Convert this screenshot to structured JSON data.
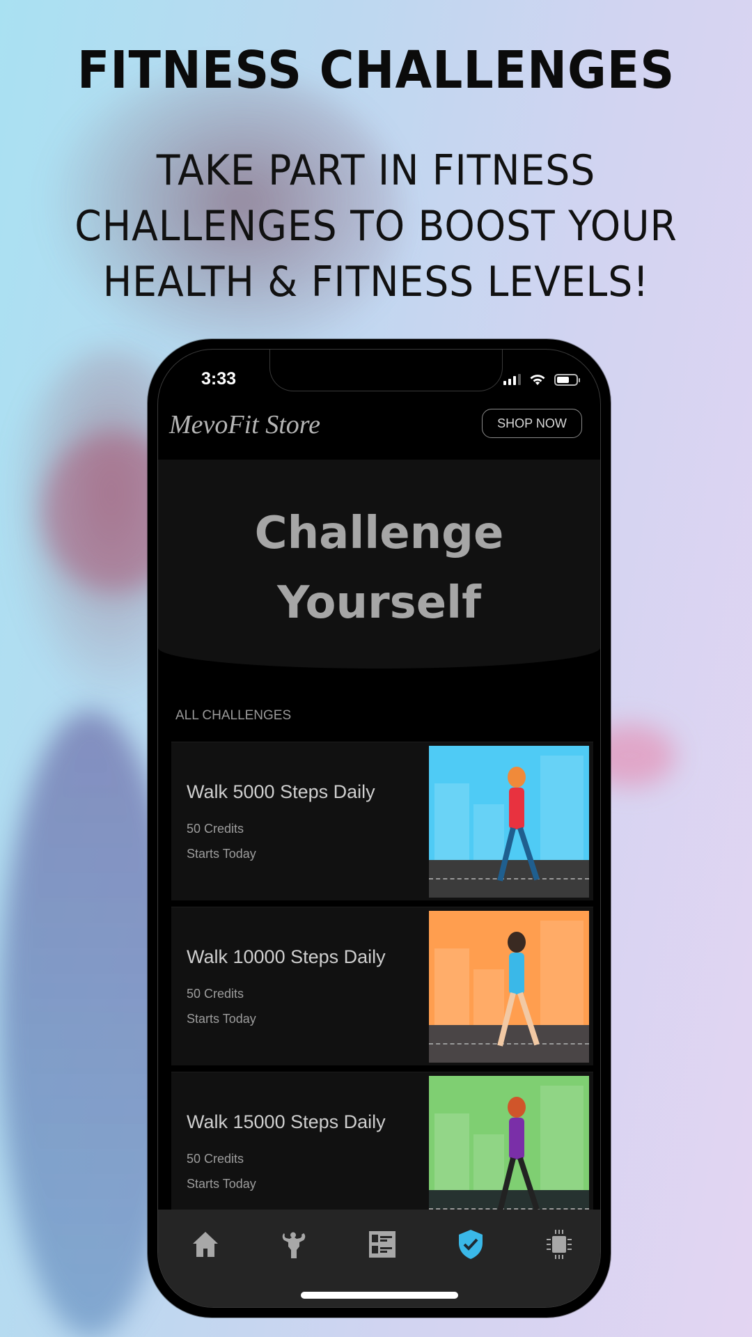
{
  "promo": {
    "headline": "FITNESS CHALLENGES",
    "subhead_lines": [
      "TAKE PART IN FITNESS",
      "CHALLENGES TO BOOST YOUR",
      "HEALTH & FITNESS LEVELS!"
    ]
  },
  "status_bar": {
    "time": "3:33",
    "icons": [
      "signal-icon",
      "wifi-icon",
      "battery-icon"
    ]
  },
  "app_bar": {
    "brand": "MevoFit Store",
    "shop_button": "SHOP NOW"
  },
  "hero": {
    "title_lines": [
      "Challenge",
      "Yourself"
    ]
  },
  "section": {
    "label": "ALL CHALLENGES"
  },
  "challenges": [
    {
      "title": "Walk 5000 Steps Daily",
      "credits": "50 Credits",
      "start": "Starts Today",
      "theme": "blue",
      "bg": "#4fcbf5"
    },
    {
      "title": "Walk 10000 Steps Daily",
      "credits": "50 Credits",
      "start": "Starts Today",
      "theme": "orange",
      "bg": "#ff9e4f"
    },
    {
      "title": "Walk 15000 Steps Daily",
      "credits": "50 Credits",
      "start": "Starts Today",
      "theme": "green",
      "bg": "#7fcf72"
    }
  ],
  "tabbar": {
    "items": [
      {
        "name": "home",
        "icon": "home-icon",
        "active": false
      },
      {
        "name": "workout",
        "icon": "bodybuilder-icon",
        "active": false
      },
      {
        "name": "plans",
        "icon": "list-icon",
        "active": false
      },
      {
        "name": "challenges",
        "icon": "shield-check-icon",
        "active": true
      },
      {
        "name": "devices",
        "icon": "chip-icon",
        "active": false
      }
    ],
    "active_color": "#3ab8e8",
    "inactive_color": "#a8a8a8"
  }
}
